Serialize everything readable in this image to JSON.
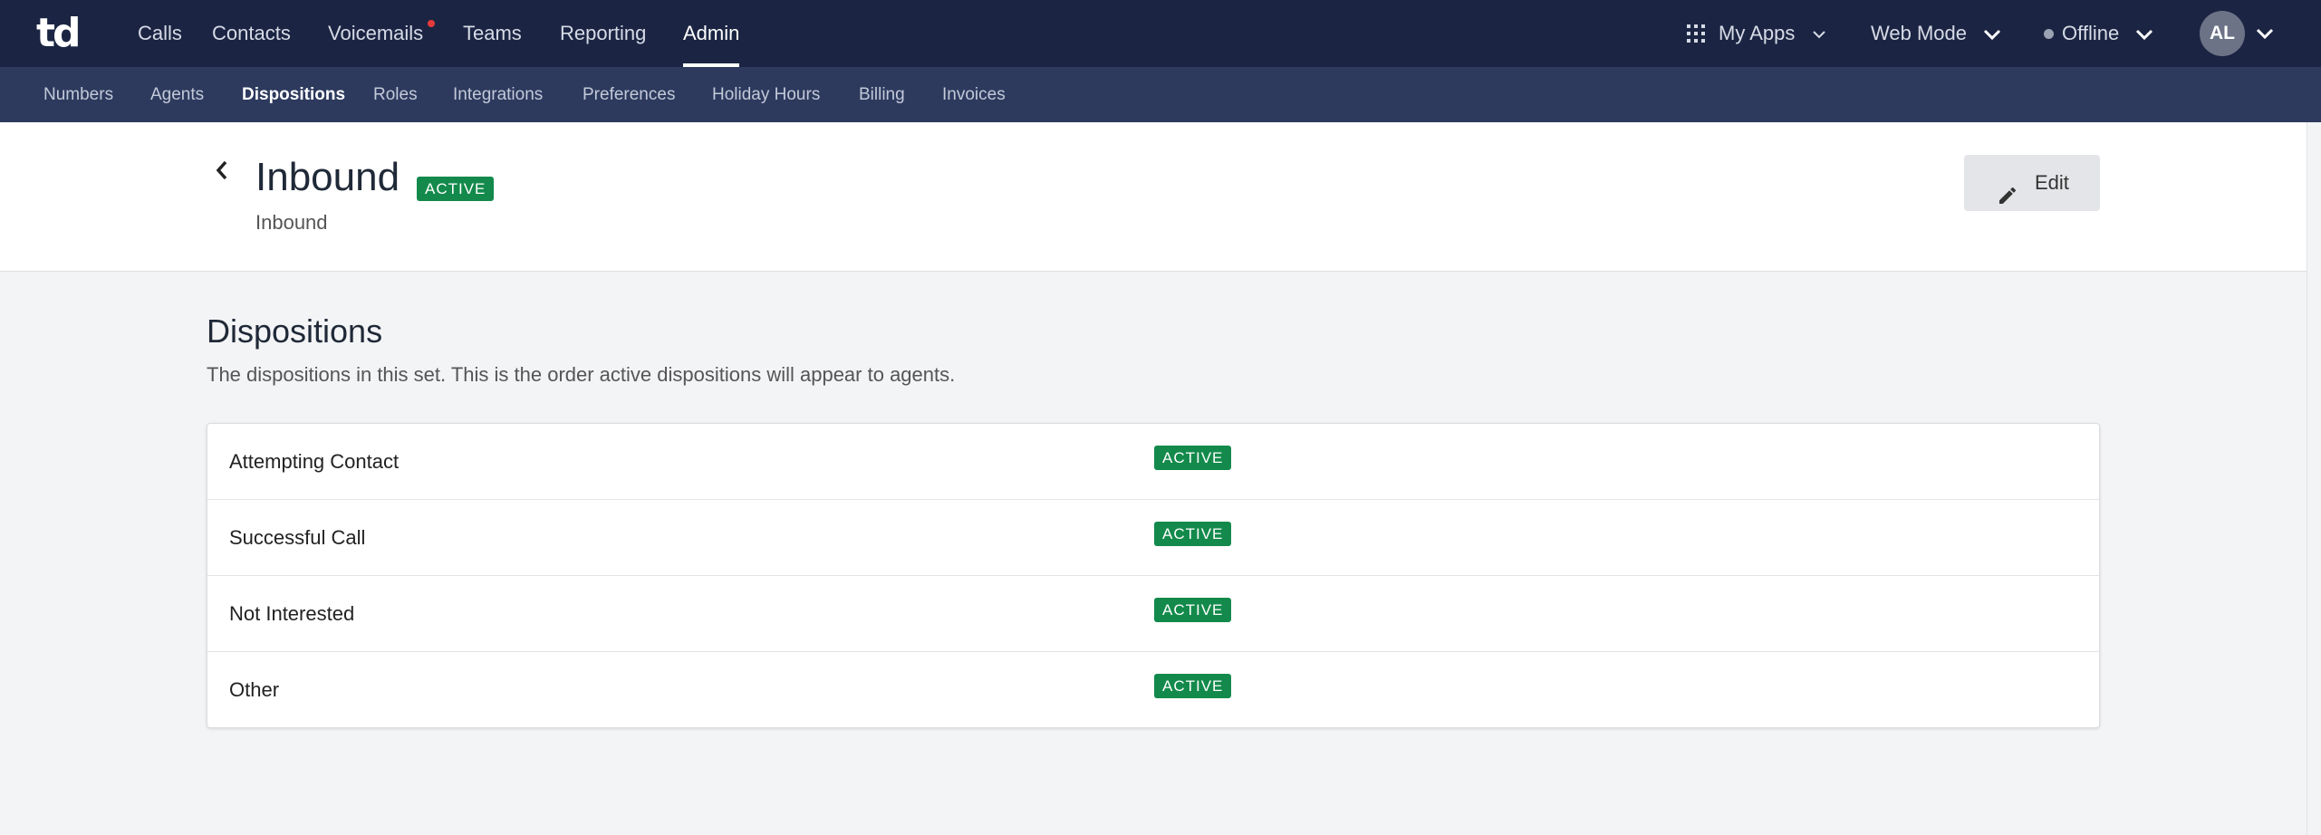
{
  "app": {
    "logo_text": "td"
  },
  "topnav": {
    "items": [
      {
        "label": "Calls"
      },
      {
        "label": "Contacts"
      },
      {
        "label": "Voicemails"
      },
      {
        "label": "Teams"
      },
      {
        "label": "Reporting"
      },
      {
        "label": "Admin",
        "active": true
      }
    ],
    "my_apps_label": "My Apps",
    "web_mode_label": "Web Mode",
    "status_label": "Offline",
    "avatar_initials": "AL"
  },
  "subnav": {
    "items": [
      {
        "label": "Numbers"
      },
      {
        "label": "Agents"
      },
      {
        "label": "Dispositions",
        "active": true
      },
      {
        "label": "Roles"
      },
      {
        "label": "Integrations"
      },
      {
        "label": "Preferences"
      },
      {
        "label": "Holiday Hours"
      },
      {
        "label": "Billing"
      },
      {
        "label": "Invoices"
      }
    ]
  },
  "header": {
    "title": "Inbound",
    "status": "ACTIVE",
    "subtitle": "Inbound",
    "edit_label": "Edit"
  },
  "section": {
    "title": "Dispositions",
    "description": "The dispositions in this set. This is the order active dispositions will appear to agents."
  },
  "dispositions": [
    {
      "name": "Attempting Contact",
      "status": "ACTIVE"
    },
    {
      "name": "Successful Call",
      "status": "ACTIVE"
    },
    {
      "name": "Not Interested",
      "status": "ACTIVE"
    },
    {
      "name": "Other",
      "status": "ACTIVE"
    }
  ],
  "colors": {
    "topbar": "#1b2543",
    "subbar": "#2d3a5e",
    "badge_active": "#138a4b",
    "notification_dot": "#e63b3b"
  },
  "icons": {
    "apps": "grid-icon",
    "back": "chevron-left-icon",
    "edit": "pencil-icon",
    "dropdown": "chevron-down-icon",
    "status": "status-dot-icon"
  }
}
